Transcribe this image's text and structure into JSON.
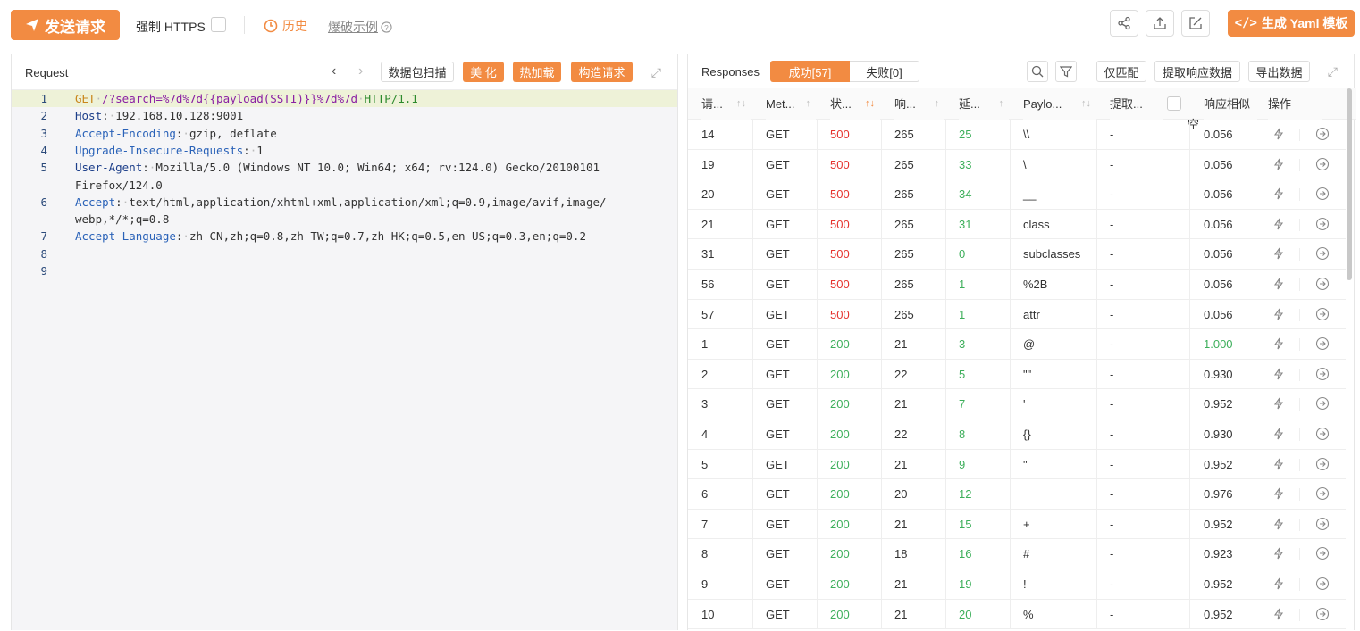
{
  "top": {
    "send_label": "发送请求",
    "https_label": "强制 HTTPS",
    "history_label": "历史",
    "example_label": "爆破示例",
    "yaml_label": "生成 Yaml 模板"
  },
  "request": {
    "title": "Request",
    "buttons": {
      "scan": "数据包扫描",
      "beautify": "美 化",
      "hotload": "热加载",
      "build": "构造请求"
    },
    "lines": [
      {
        "n": "1",
        "method": "GET",
        "path": "/?search=%7d%7d{{payload(SSTI)}}%7d%7d",
        "ver": "HTTP/1.1"
      },
      {
        "n": "2",
        "hdr": "Host",
        "val": "192.168.10.128:9001"
      },
      {
        "n": "3",
        "hdr": "Accept-Encoding",
        "val": "gzip, deflate"
      },
      {
        "n": "4",
        "hdr": "Upgrade-Insecure-Requests",
        "val": "1"
      },
      {
        "n": "5",
        "hdr": "User-Agent",
        "val": "Mozilla/5.0 (Windows NT 10.0; Win64; x64; rv:124.0) Gecko/20100101",
        "cont": "Firefox/124.0"
      },
      {
        "n": "6",
        "hdr": "Accept",
        "val": "text/html,application/xhtml+xml,application/xml;q=0.9,image/avif,image/",
        "cont": "webp,*/*;q=0.8"
      },
      {
        "n": "7",
        "hdr": "Accept-Language",
        "val": "zh-CN,zh;q=0.8,zh-TW;q=0.7,zh-HK;q=0.5,en-US;q=0.3,en;q=0.2"
      },
      {
        "n": "8"
      },
      {
        "n": "9"
      }
    ]
  },
  "responses": {
    "title": "Responses",
    "tab_success": "成功[57]",
    "tab_fail": "失败[0]",
    "btn_match": "仅匹配",
    "btn_extract": "提取响应数据",
    "btn_export": "导出数据",
    "columns": [
      "请...",
      "Met...",
      "状...",
      "响...",
      "延...",
      "Paylo...",
      "提取...",
      "响应相似",
      "操作"
    ],
    "empty_hint": "空",
    "colors": {
      "error": "#e5322d",
      "ok": "#3daf5b",
      "accent": "#f28b42"
    },
    "rows": [
      {
        "id": "14",
        "method": "GET",
        "status": "500",
        "len": "265",
        "delay": "25",
        "payload": "\\\\",
        "extract": "-",
        "sim": "0.056"
      },
      {
        "id": "19",
        "method": "GET",
        "status": "500",
        "len": "265",
        "delay": "33",
        "payload": "\\",
        "extract": "-",
        "sim": "0.056"
      },
      {
        "id": "20",
        "method": "GET",
        "status": "500",
        "len": "265",
        "delay": "34",
        "payload": "__",
        "extract": "-",
        "sim": "0.056"
      },
      {
        "id": "21",
        "method": "GET",
        "status": "500",
        "len": "265",
        "delay": "31",
        "payload": "class",
        "extract": "-",
        "sim": "0.056"
      },
      {
        "id": "31",
        "method": "GET",
        "status": "500",
        "len": "265",
        "delay": "0",
        "payload": "subclasses",
        "extract": "-",
        "sim": "0.056"
      },
      {
        "id": "56",
        "method": "GET",
        "status": "500",
        "len": "265",
        "delay": "1",
        "payload": "%2B",
        "extract": "-",
        "sim": "0.056"
      },
      {
        "id": "57",
        "method": "GET",
        "status": "500",
        "len": "265",
        "delay": "1",
        "payload": "attr",
        "extract": "-",
        "sim": "0.056"
      },
      {
        "id": "1",
        "method": "GET",
        "status": "200",
        "len": "21",
        "delay": "3",
        "payload": "@",
        "extract": "-",
        "sim": "1.000"
      },
      {
        "id": "2",
        "method": "GET",
        "status": "200",
        "len": "22",
        "delay": "5",
        "payload": "\"\"",
        "extract": "-",
        "sim": "0.930"
      },
      {
        "id": "3",
        "method": "GET",
        "status": "200",
        "len": "21",
        "delay": "7",
        "payload": "'",
        "extract": "-",
        "sim": "0.952"
      },
      {
        "id": "4",
        "method": "GET",
        "status": "200",
        "len": "22",
        "delay": "8",
        "payload": "{}",
        "extract": "-",
        "sim": "0.930"
      },
      {
        "id": "5",
        "method": "GET",
        "status": "200",
        "len": "21",
        "delay": "9",
        "payload": "\"",
        "extract": "-",
        "sim": "0.952"
      },
      {
        "id": "6",
        "method": "GET",
        "status": "200",
        "len": "20",
        "delay": "12",
        "payload": "",
        "extract": "-",
        "sim": "0.976"
      },
      {
        "id": "7",
        "method": "GET",
        "status": "200",
        "len": "21",
        "delay": "15",
        "payload": "+",
        "extract": "-",
        "sim": "0.952"
      },
      {
        "id": "8",
        "method": "GET",
        "status": "200",
        "len": "18",
        "delay": "16",
        "payload": "#",
        "extract": "-",
        "sim": "0.923"
      },
      {
        "id": "9",
        "method": "GET",
        "status": "200",
        "len": "21",
        "delay": "19",
        "payload": "!",
        "extract": "-",
        "sim": "0.952"
      },
      {
        "id": "10",
        "method": "GET",
        "status": "200",
        "len": "21",
        "delay": "20",
        "payload": "%",
        "extract": "-",
        "sim": "0.952"
      }
    ]
  }
}
